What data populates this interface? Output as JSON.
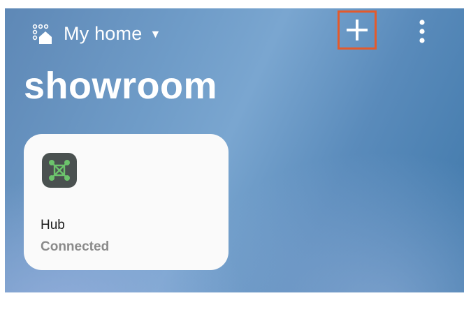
{
  "header": {
    "location_label": "My home",
    "location_icon": "home-location-icon",
    "dropdown_icon": "caret-down-icon",
    "add_icon": "plus-icon",
    "more_icon": "more-vertical-icon",
    "highlight_color": "#e35a2c"
  },
  "room": {
    "title": "showroom"
  },
  "devices": [
    {
      "name": "Hub",
      "status": "Connected",
      "icon": "hub-icon",
      "icon_color": "#6cc36c"
    }
  ]
}
